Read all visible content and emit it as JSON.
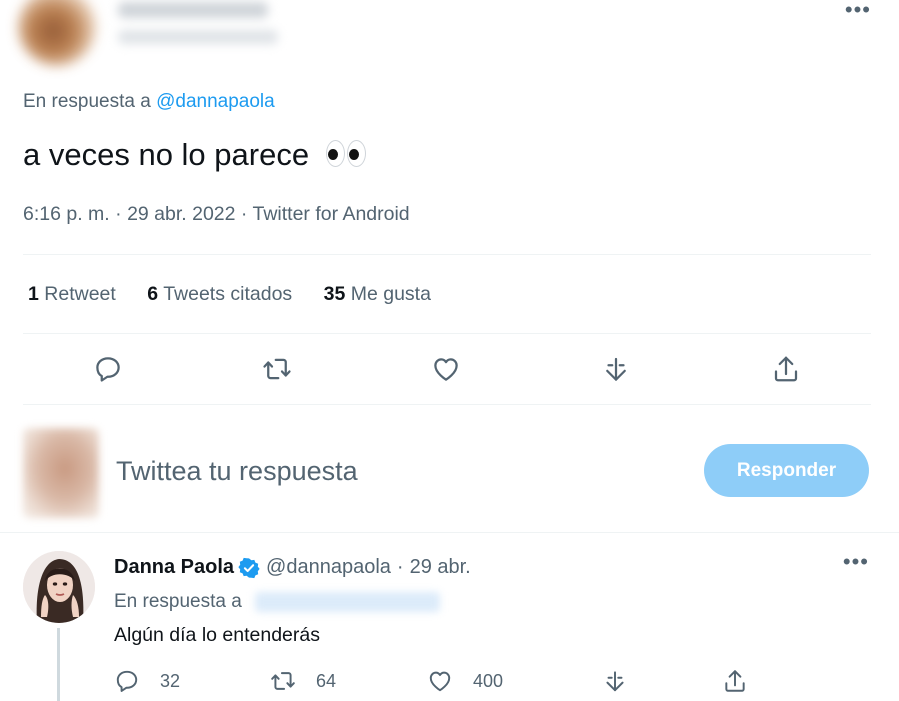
{
  "tweet": {
    "reply_prefix": "En respuesta a",
    "reply_handle": "@dannapaola",
    "text": "a veces no lo parece",
    "emoji_name": "eyes-emoji",
    "time": "6:16 p. m.",
    "sep": "·",
    "date": "29 abr. 2022",
    "source": "Twitter for Android",
    "more_label": "•••"
  },
  "stats": {
    "retweets_count": "1",
    "retweets_label": "Retweet",
    "quotes_count": "6",
    "quotes_label": "Tweets citados",
    "likes_count": "35",
    "likes_label": "Me gusta"
  },
  "actions": [
    "reply-icon",
    "retweet-icon",
    "like-icon",
    "bookmark-icon",
    "share-icon"
  ],
  "compose": {
    "placeholder": "Twittea tu respuesta",
    "button_label": "Responder"
  },
  "reply_tweet": {
    "name": "Danna Paola",
    "handle": "@dannapaola",
    "sep": "·",
    "date": "29 abr.",
    "reply_prefix": "En respuesta a",
    "text": "Algún día lo entenderás",
    "reply_count": "32",
    "retweet_count": "64",
    "like_count": "400",
    "more_label": "•••"
  },
  "colors": {
    "accent": "#1d9bf0",
    "button_disabled": "#8ecdf8",
    "secondary_text": "#536471",
    "primary_text": "#0f1419"
  }
}
